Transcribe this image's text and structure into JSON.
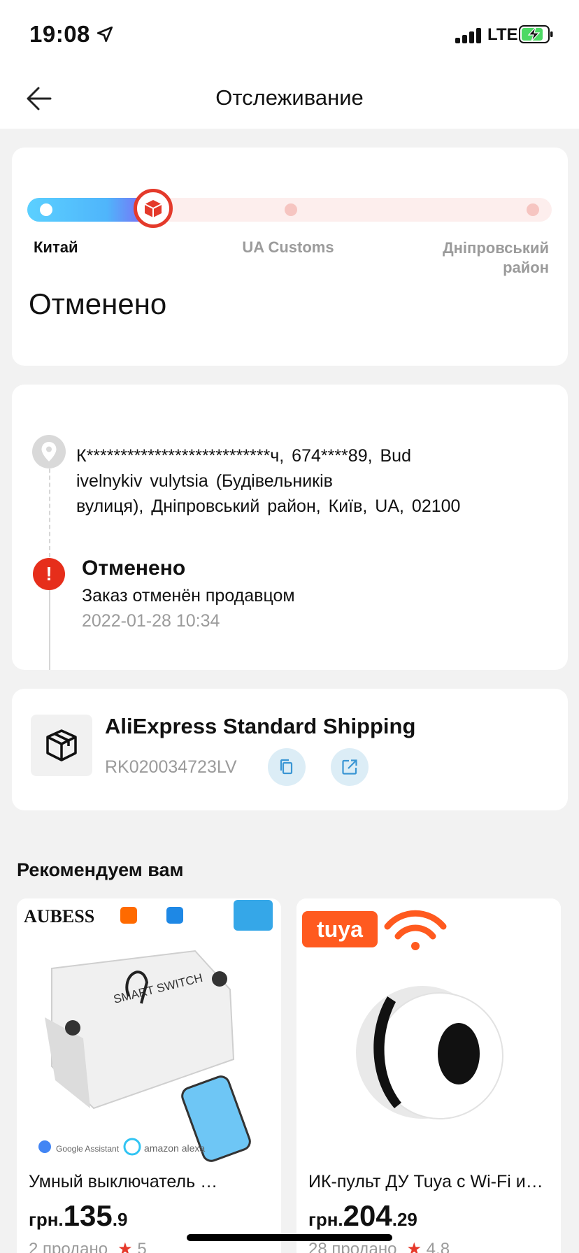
{
  "status_bar": {
    "time": "19:08",
    "network": "LTE"
  },
  "header": {
    "title": "Отслеживание"
  },
  "progress": {
    "origin": "Китай",
    "middle": "UA Customs",
    "destination_line1": "Дніпровський",
    "destination_line2": "район",
    "status": "Отменено"
  },
  "timeline": {
    "address_line1": "К***************************ч, 674****89, Bud",
    "address_line2": "ivelnykiv vulytsia (Будівельників",
    "address_line3": "вулиця), Дніпровський район, Київ, UA, 02100",
    "event_title": "Отменено",
    "event_desc": "Заказ отменён продавцом",
    "event_time": "2022-01-28 10:34"
  },
  "shipping": {
    "name": "AliExpress Standard Shipping",
    "tracking_number": "RK020034723LV"
  },
  "recommend_title": "Рекомендуем вам",
  "products": [
    {
      "name": "Умный выключатель …",
      "currency": "грн.",
      "price_int": "135",
      "price_dec": ".9",
      "sold": "2 продано",
      "rating": "5",
      "img_brand": "AUBESS",
      "img_text1": "SMART SWITCH",
      "img_text2": "Google Assistant",
      "img_text3": "amazon alexa"
    },
    {
      "name": "ИК-пульт ДУ Tuya с Wi-Fi и…",
      "currency": "грн.",
      "price_int": "204",
      "price_dec": ".29",
      "sold": "28 продано",
      "rating": "4.8",
      "img_brand": "tuya"
    }
  ],
  "colors": {
    "accent": "#e43a2b",
    "progress_blue": "#4fb5fb"
  }
}
